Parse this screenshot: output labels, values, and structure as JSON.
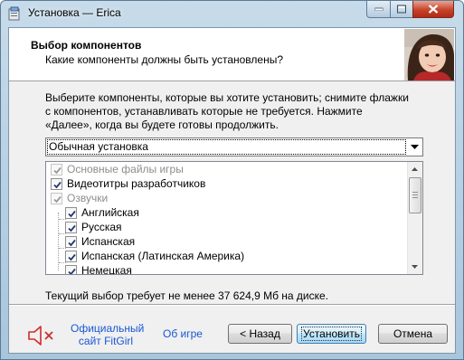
{
  "window": {
    "title": "Установка — Erica"
  },
  "header": {
    "title": "Выбор компонентов",
    "subtitle": "Какие компоненты должны быть установлены?"
  },
  "description": "Выберите компоненты, которые вы хотите установить; снимите флажки с компонентов, устанавливать которые не требуется. Нажмите «Далее», когда вы будете готовы продолжить.",
  "install_type": {
    "selected": "Обычная установка"
  },
  "components": [
    {
      "label": "Основные файлы игры",
      "checked": true,
      "disabled": true,
      "level": 0
    },
    {
      "label": "Видеотитры разработчиков",
      "checked": true,
      "disabled": false,
      "level": 0
    },
    {
      "label": "Озвучки",
      "checked": true,
      "disabled": true,
      "level": 0
    },
    {
      "label": "Английская",
      "checked": true,
      "disabled": false,
      "level": 1
    },
    {
      "label": "Русская",
      "checked": true,
      "disabled": false,
      "level": 1
    },
    {
      "label": "Испанская",
      "checked": true,
      "disabled": false,
      "level": 1
    },
    {
      "label": "Испанская (Латинская Америка)",
      "checked": true,
      "disabled": false,
      "level": 1
    },
    {
      "label": "Немецкая",
      "checked": true,
      "disabled": false,
      "level": 1
    }
  ],
  "disk_space_text": "Текущий выбор требует не менее 37 624,9 Мб на диске.",
  "footer": {
    "link_fitgirl_line1": "Официальный",
    "link_fitgirl_line2": "сайт FitGirl",
    "link_about": "Об игре",
    "back_label": "< Назад",
    "install_label": "Установить",
    "cancel_label": "Отмена"
  },
  "colors": {
    "link": "#1a56d6",
    "mute_icon": "#d22b2b"
  }
}
